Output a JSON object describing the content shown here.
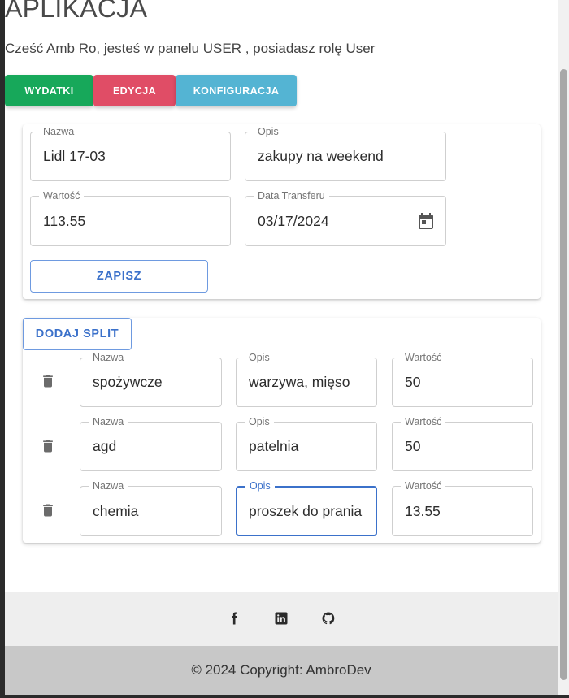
{
  "app": {
    "title": "APLIKACJA",
    "greeting": "Cześć Amb Ro, jesteś w panelu USER , posiadasz rolę User"
  },
  "nav": {
    "wydatki": "WYDATKI",
    "edycja": "EDYCJA",
    "konfiguracja": "KONFIGURACJA"
  },
  "form": {
    "nazwa_label": "Nazwa",
    "nazwa_value": "Lidl 17-03",
    "opis_label": "Opis",
    "opis_value": "zakupy na weekend",
    "wartosc_label": "Wartość",
    "wartosc_value": "113.55",
    "data_label": "Data Transferu",
    "data_value": "03/17/2024",
    "save_label": "ZAPISZ"
  },
  "splits": {
    "add_label": "DODAJ SPLIT",
    "rows": [
      {
        "nazwa_label": "Nazwa",
        "nazwa": "spożywcze",
        "opis_label": "Opis",
        "opis": "warzywa, mięso",
        "wartosc_label": "Wartość",
        "wartosc": "50"
      },
      {
        "nazwa_label": "Nazwa",
        "nazwa": "agd",
        "opis_label": "Opis",
        "opis": "patelnia",
        "wartosc_label": "Wartość",
        "wartosc": "50"
      },
      {
        "nazwa_label": "Nazwa",
        "nazwa": "chemia",
        "opis_label": "Opis",
        "opis": "proszek do prania",
        "wartosc_label": "Wartość",
        "wartosc": "13.55"
      }
    ]
  },
  "footer": {
    "social_icons": [
      "facebook-icon",
      "linkedin-icon",
      "github-icon"
    ],
    "copyright": "© 2024 Copyright: AmbroDev"
  },
  "colors": {
    "green": "#17a85a",
    "red": "#e04d66",
    "blue": "#54b4d3",
    "primary": "#3b71ca"
  }
}
